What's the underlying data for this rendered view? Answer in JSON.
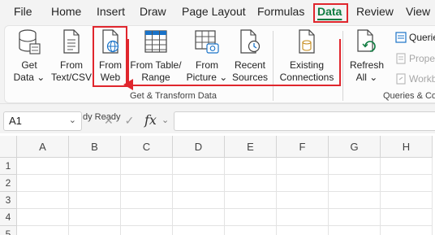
{
  "menu": {
    "tabs": [
      "File",
      "Home",
      "Insert",
      "Draw",
      "Page Layout",
      "Formulas",
      "Data",
      "Review",
      "View"
    ],
    "active_tab": "Data"
  },
  "ribbon": {
    "get_data": {
      "line1": "Get",
      "line2": "Data ⌄"
    },
    "from_text_csv": {
      "line1": "From",
      "line2": "Text/CSV"
    },
    "from_web": {
      "line1": "From",
      "line2": "Web"
    },
    "from_table_range": {
      "line1": "From Table/",
      "line2": "Range"
    },
    "from_picture": {
      "line1": "From",
      "line2": "Picture ⌄"
    },
    "recent_sources": {
      "line1": "Recent",
      "line2": "Sources"
    },
    "existing_connections": {
      "line1": "Existing",
      "line2": "Connections"
    },
    "get_transform_label": "Get & Transform Data",
    "refresh_all": {
      "line1": "Refresh",
      "line2": "All ⌄"
    },
    "queries_items": [
      "Querie",
      "Proper",
      "Workbo"
    ],
    "queries_label": "Queries & Co"
  },
  "formula_bar": {
    "name_box": "A1",
    "status_overlap": "dy Ready",
    "cancel_glyph": "✕",
    "enter_glyph": "✓",
    "fx": "fx"
  },
  "grid": {
    "columns": [
      "A",
      "B",
      "C",
      "D",
      "E",
      "F",
      "G",
      "H"
    ],
    "rows": [
      "1",
      "2",
      "3",
      "4",
      "5"
    ]
  },
  "annotation_color": "#e0262d"
}
